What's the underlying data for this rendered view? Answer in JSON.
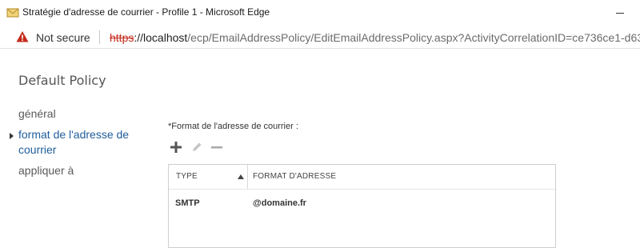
{
  "window": {
    "title": "Stratégie d'adresse de courrier - Profile 1 - Microsoft Edge",
    "icon": "mail-app-icon"
  },
  "addressbar": {
    "security_label": "Not secure",
    "url_scheme": "https",
    "url_host": "://localhost",
    "url_path": "/ecp/EmailAddressPolicy/EditEmailAddressPolicy.aspx?ActivityCorrelationID=ce736ce1-d63",
    "warning_color": "#c42b1c"
  },
  "page": {
    "title": "Default Policy"
  },
  "nav": {
    "items": [
      {
        "label": "général"
      },
      {
        "label_line1": "format de l'adresse de",
        "label_line2": "courrier",
        "selected": true
      },
      {
        "label": "appliquer à"
      }
    ],
    "selected_color": "#1e5d9b"
  },
  "main": {
    "field_label": "*Format de l'adresse de courrier :",
    "toolbar": {
      "add_icon": "plus-icon",
      "edit_icon": "pencil-icon",
      "remove_icon": "minus-icon"
    },
    "table": {
      "columns": [
        "TYPE",
        "FORMAT D'ADRESSE"
      ],
      "sort_icon": "sort-ascending-icon",
      "rows": [
        {
          "type": "SMTP",
          "format": "@domaine.fr"
        }
      ]
    }
  }
}
